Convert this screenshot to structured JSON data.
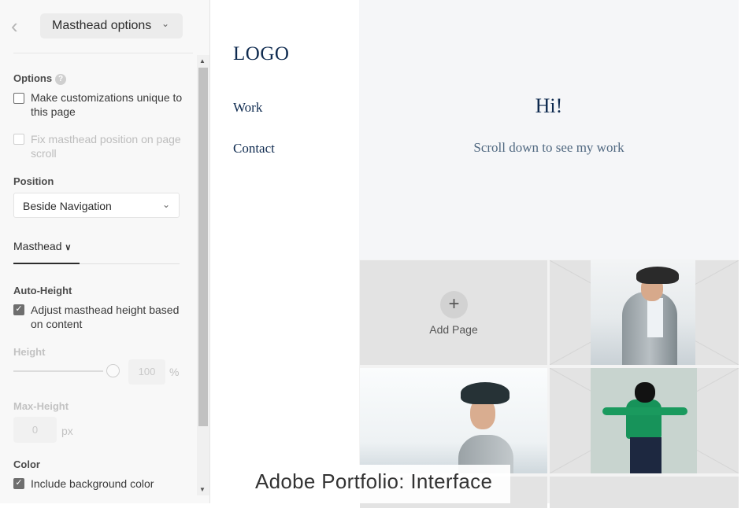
{
  "panel": {
    "back_icon": "chevron-left-icon",
    "title": "Masthead options",
    "options_label": "Options",
    "help_icon": "?",
    "unique_label": "Make customizations unique to this page",
    "unique_checked": false,
    "fix_label": "Fix masthead position on page scroll",
    "fix_checked": false,
    "position_label": "Position",
    "position_value": "Beside Navigation",
    "tab_label": "Masthead",
    "autoheight_label": "Auto-Height",
    "adjust_label": "Adjust masthead height based on content",
    "adjust_checked": true,
    "height_label": "Height",
    "height_value": "100",
    "height_unit": "%",
    "height_slider_percent": 100,
    "maxheight_label": "Max-Height",
    "maxheight_value": "0",
    "maxheight_unit": "px",
    "color_label": "Color",
    "bgcolor_label": "Include background color",
    "bgcolor_checked": true,
    "check_glyph": "✓"
  },
  "site": {
    "logo": "LOGO",
    "nav": [
      "Work",
      "Contact"
    ],
    "hero_title": "Hi!",
    "hero_subtitle": "Scroll down to see my work",
    "add_page_plus": "+",
    "add_page_label": "Add Page",
    "text_color": "#0e2a4f"
  },
  "caption": "Adobe Portfolio: Interface"
}
